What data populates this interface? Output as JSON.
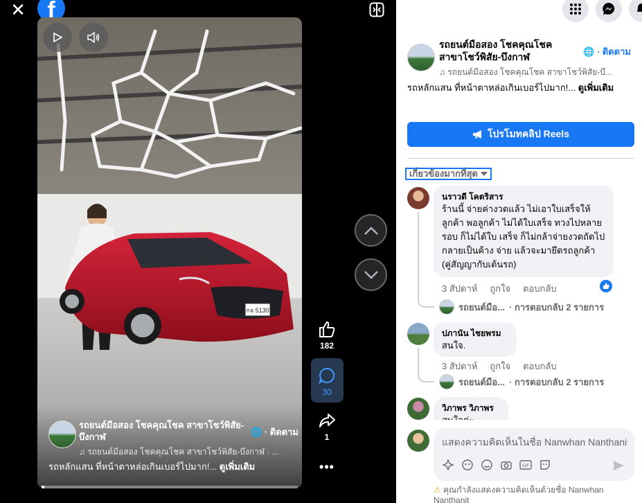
{
  "viewer": {
    "progress_percent": 1,
    "actions": {
      "like_count": "182",
      "comment_count": "30",
      "share_count": "1"
    },
    "video_overlay": {
      "page_name": "รถยนต์มือสอง โชคคุณโชค สาขาโชว์พิสัย-บึงกาฬ",
      "follow_label": "· ติดตาม",
      "audio": "♫ รถยนต์มือสอง โชคคุณโชค สาขาโชว์พิสัย-บึงกาฬ · ...",
      "caption": "รถหลักแสน ที่หน้าตาหล่อเกินเบอร์ไปมาก!... ",
      "see_more": "ดูเพิ่มเติม"
    },
    "license_plate": "กจ 5130"
  },
  "panel": {
    "page_name": "รถยนต์มือสอง โชคคุณโชค สาขาโชว์พิสัย-บึงกาฬ",
    "follow_sep": "· ",
    "follow_label": "ติดตาม",
    "audio": "♫ รถยนต์มือสอง โชคคุณโชค สาขาโชว์พิสัย-บึ...",
    "caption": "รถหลักแสน ที่หน้าตาหล่อเกินเบอร์ไปมาก!... ",
    "see_more": "ดูเพิ่มเติม",
    "promote_label": "โปรโมทคลิป Reels",
    "sort_label": "เกี่ยวข้องมากที่สุด",
    "comments": [
      {
        "name": "นราวดี โคตริสาร",
        "text": "ร้านนี้ จ่ายค่างวดแล้ว ไม่เอาใบเสร็จให้ลูกค้า พอลูกค้า ไม่ได้ใบเสร็จ ทวงไปหลายรอบ ก็ไม่ได้ใบ เสร็จ ก็ไม่กล้าจ่ายงวดถัดไป กลายเป็นค้าง จ่าย แล้วจะมายึดรถลูกค้า (คู่สัญญากับเต้นรถ)",
        "time": "3 สัปดาห์",
        "like": "ถูกใจ",
        "reply": "ตอบกลับ",
        "replier": "รถยนต์มือ...",
        "replies": "· การตอบกลับ 2 รายการ"
      },
      {
        "name": "ปภานัน ไชยพรม",
        "text": "สนใจ.",
        "time": "3 สัปดาห์",
        "like": "ถูกใจ",
        "reply": "ตอบกลับ",
        "replier": "รถยนต์มือ...",
        "replies": "· การตอบกลับ 2 รายการ"
      },
      {
        "name": "วิภาพร วิภาพร",
        "text": "สนใจค่ะ"
      }
    ],
    "composer": {
      "placeholder": "แสดงความคิดเห็นในชื่อ Nanwhan Nanthanit",
      "warning": "คุณกำลังแสดงความคิดเห็นด้วยชื่อ Nanwhan Nanthanit"
    }
  }
}
